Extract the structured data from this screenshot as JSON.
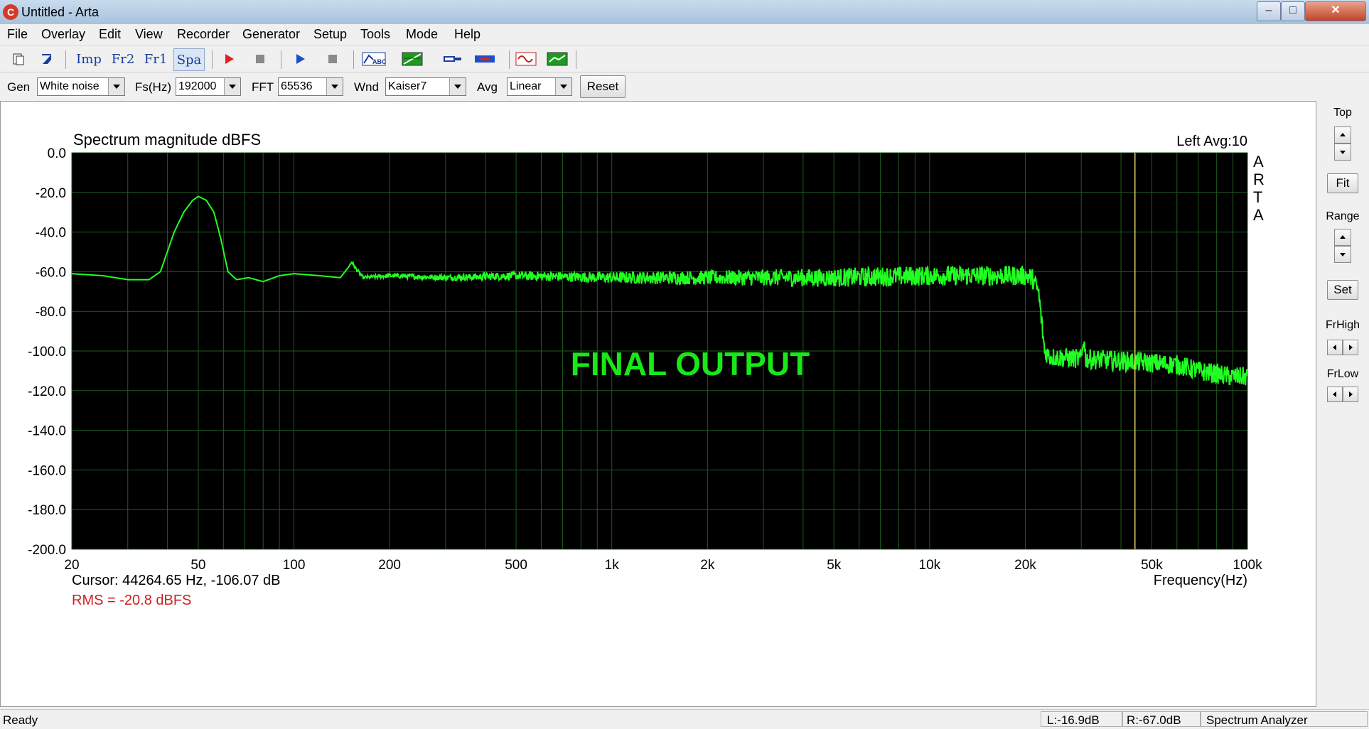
{
  "window": {
    "title": "Untitled - Arta",
    "app_icon": "C",
    "min_label": "–",
    "max_label": "□",
    "close_label": "✕"
  },
  "menu": [
    "File",
    "Overlay",
    "Edit",
    "View",
    "Recorder",
    "Generator",
    "Setup",
    "Tools",
    "Mode",
    "Help"
  ],
  "toolbar": {
    "imp": "Imp",
    "fr2": "Fr2",
    "fr1": "Fr1",
    "spa": "Spa",
    "icons": [
      "new-document-icon",
      "open-arrow-icon",
      "impulse-mode-icon",
      "fr2-mode-icon",
      "fr1-mode-icon",
      "spectrum-mode-icon",
      "record-icon",
      "stop-icon",
      "play-icon",
      "stop-playback-icon",
      "abc-scope-icon",
      "spectrum-view-icon",
      "probe-icon",
      "bars-icon",
      "waveform-icon",
      "chart-icon"
    ],
    "colors": {
      "record": "#e02020",
      "play": "#1a4fd0",
      "stop": "#8a8a8a",
      "waveform_bg": "#ffffff",
      "chart_bg": "#1e9a1e"
    }
  },
  "controls": {
    "gen_label": "Gen",
    "gen_value": "White noise",
    "fs_label": "Fs(Hz)",
    "fs_value": "192000",
    "fft_label": "FFT",
    "fft_value": "65536",
    "wnd_label": "Wnd",
    "wnd_value": "Kaiser7",
    "avg_label": "Avg",
    "avg_value": "Linear",
    "reset_label": "Reset"
  },
  "right_panel": {
    "top_label": "Top",
    "fit_label": "Fit",
    "range_label": "Range",
    "set_label": "Set",
    "frhigh_label": "FrHigh",
    "frlow_label": "FrLow"
  },
  "plot": {
    "cursor_text": "Cursor: 44264.65 Hz, -106.07 dB",
    "rms_text": "RMS =  -20.8 dBFS",
    "overlay_text": "FINAL OUTPUT",
    "brand_letters": [
      "A",
      "R",
      "T",
      "A"
    ],
    "channel_text": "Left  Avg:10",
    "cursor_freq_hz": 44264.65,
    "colors": {
      "background": "#000000",
      "grid": "#1f5a1f",
      "trace": "#22ff22",
      "cursor": "#e0d060",
      "rms": "#d02020",
      "overlay": "#18e818"
    }
  },
  "chart_data": {
    "type": "line",
    "title": "Spectrum magnitude dBFS",
    "xlabel": "Frequency(Hz)",
    "ylabel": "",
    "x_scale": "log",
    "xlim": [
      20,
      100000
    ],
    "ylim": [
      -200,
      0
    ],
    "grid": true,
    "x_ticks": [
      20,
      50,
      100,
      200,
      500,
      1000,
      2000,
      5000,
      10000,
      20000,
      50000,
      100000
    ],
    "x_tick_labels": [
      "20",
      "50",
      "100",
      "200",
      "500",
      "1k",
      "2k",
      "5k",
      "10k",
      "20k",
      "50k",
      "100k"
    ],
    "y_ticks": [
      0,
      -20,
      -40,
      -60,
      -80,
      -100,
      -120,
      -140,
      -160,
      -180,
      -200
    ],
    "y_tick_labels": [
      "0.0",
      "-20.0",
      "-40.0",
      "-60.0",
      "-80.0",
      "-100.0",
      "-120.0",
      "-140.0",
      "-160.0",
      "-180.0",
      "-200.0"
    ],
    "series": [
      {
        "x": [
          20,
          25,
          30,
          35,
          38,
          42,
          45,
          48,
          50,
          53,
          56,
          59,
          62,
          66,
          72,
          80,
          90,
          100,
          120,
          140,
          148,
          152,
          156,
          165,
          200,
          300,
          500,
          1000,
          2000,
          5000,
          10000,
          15000,
          20000,
          21000,
          22000,
          22500,
          23000,
          24000,
          30000,
          30500,
          31000,
          40000,
          50000,
          60000,
          70000,
          90000,
          100000
        ],
        "y": [
          -61,
          -62,
          -64,
          -64,
          -60,
          -40,
          -30,
          -24,
          -22,
          -24,
          -30,
          -44,
          -60,
          -64,
          -63,
          -65,
          -62,
          -61,
          -62,
          -63,
          -58,
          -55,
          -58,
          -63,
          -62,
          -63,
          -62,
          -63,
          -63,
          -63,
          -62,
          -62,
          -62,
          -63,
          -70,
          -85,
          -100,
          -103,
          -104,
          -93,
          -104,
          -105,
          -106,
          -107,
          -110,
          -113,
          -113
        ]
      }
    ]
  },
  "status": {
    "ready": "Ready",
    "left_level": "L:-16.9dB",
    "right_level": "R:-67.0dB",
    "mode": "Spectrum Analyzer"
  }
}
